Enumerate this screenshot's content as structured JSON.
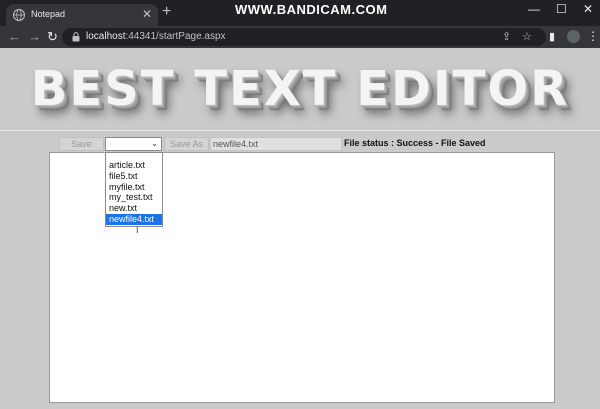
{
  "browser": {
    "tab_title": "Notepad",
    "tab_close": "✕",
    "new_tab": "+",
    "watermark": "WWW.BANDICAM.COM",
    "url_host": "localhost",
    "url_rest": ":44341/startPage.aspx",
    "window_controls": {
      "minimize": "—",
      "maximize": "☐",
      "close": "✕"
    },
    "nav": {
      "back": "←",
      "forward": "→",
      "reload": "↻"
    }
  },
  "app": {
    "banner_title": "BEST TEXT EDITOR",
    "save_label": "Save",
    "save_as_label": "Save As",
    "file_name_value": "newfile4.txt",
    "status_text": "File status : Success - File Saved",
    "file_select": {
      "selected": "",
      "options": [
        "",
        "article.txt",
        "file5.txt",
        "myfile.txt",
        "my_test.txt",
        "new.txt",
        "newfile4.txt"
      ],
      "highlighted": "newfile4.txt"
    },
    "editor_content": ""
  },
  "colors": {
    "highlight": "#1a73e8",
    "chrome_dark": "#202124",
    "page_bg": "#cacaca"
  }
}
